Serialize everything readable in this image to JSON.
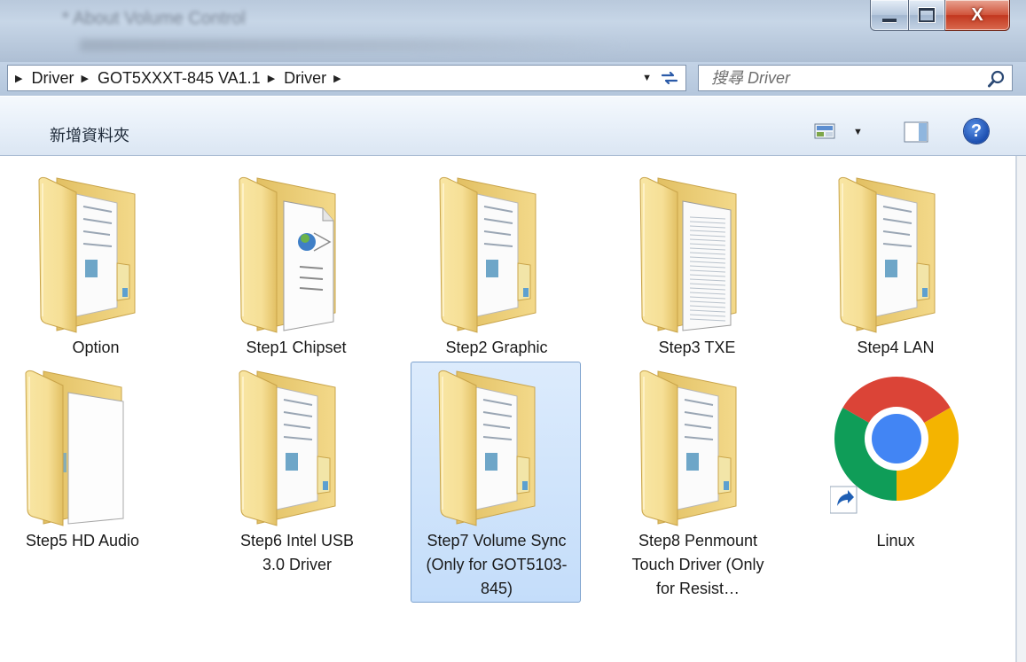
{
  "window": {
    "title": "* About Volume Control",
    "controls": {
      "minimize_icon": "minimize-icon",
      "maximize_icon": "maximize-icon",
      "close_icon": "close-icon"
    }
  },
  "address_bar": {
    "breadcrumbs": [
      "Driver",
      "GOT5XXXT-845 VA1.1",
      "Driver"
    ],
    "search_placeholder": "搜尋 Driver"
  },
  "command_bar": {
    "new_folder_label": "新增資料夾"
  },
  "items": [
    {
      "label": "Option",
      "type": "folder",
      "variant": "docs",
      "selected": false
    },
    {
      "label": "Step1  Chipset",
      "type": "folder",
      "variant": "page-globe",
      "selected": false
    },
    {
      "label": "Step2  Graphic",
      "type": "folder",
      "variant": "docs",
      "selected": false
    },
    {
      "label": "Step3  TXE",
      "type": "folder",
      "variant": "page-lined",
      "selected": false
    },
    {
      "label": "Step4  LAN",
      "type": "folder",
      "variant": "docs",
      "selected": false
    },
    {
      "label": "Step5  HD Audio",
      "type": "folder",
      "variant": "page-blank",
      "selected": false
    },
    {
      "label": "Step6  Intel USB 3.0 Driver",
      "type": "folder",
      "variant": "docs",
      "selected": false
    },
    {
      "label": "Step7  Volume Sync (Only for GOT5103-845)",
      "type": "folder",
      "variant": "docs",
      "selected": true
    },
    {
      "label": "Step8 Penmount Touch Driver (Only for Resist…",
      "type": "folder",
      "variant": "docs",
      "selected": false
    },
    {
      "label": "Linux",
      "type": "shortcut",
      "variant": "chrome",
      "selected": false
    }
  ],
  "colors": {
    "selection_fill": "#cfe3fb",
    "selection_border": "#7da2ce",
    "folder_light": "#f8e6a4",
    "folder_dark": "#e2c063"
  }
}
